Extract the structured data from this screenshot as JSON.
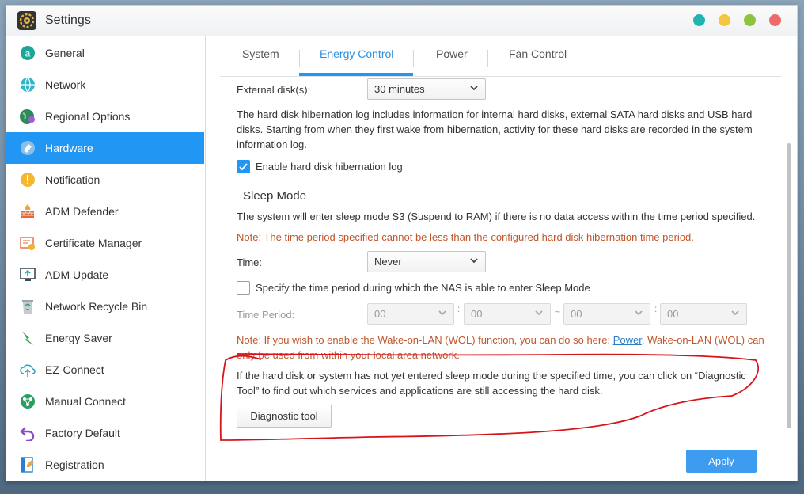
{
  "window": {
    "title": "Settings",
    "controls": {
      "teal": "#1fb4b0",
      "minimize": "#f5c542",
      "maximize": "#8bc43f",
      "close": "#ee6a6a"
    }
  },
  "sidebar": {
    "accent": "#2196f3",
    "items": [
      {
        "label": "General",
        "icon": "general-icon",
        "active": false
      },
      {
        "label": "Network",
        "icon": "globe-icon",
        "active": false
      },
      {
        "label": "Regional Options",
        "icon": "regional-globe-icon",
        "active": false
      },
      {
        "label": "Hardware",
        "icon": "hardware-icon",
        "active": true
      },
      {
        "label": "Notification",
        "icon": "exclamation-icon",
        "active": false
      },
      {
        "label": "ADM Defender",
        "icon": "firewall-icon",
        "active": false
      },
      {
        "label": "Certificate Manager",
        "icon": "certificate-icon",
        "active": false
      },
      {
        "label": "ADM Update",
        "icon": "update-monitor-icon",
        "active": false
      },
      {
        "label": "Network Recycle Bin",
        "icon": "recycle-bin-icon",
        "active": false
      },
      {
        "label": "Energy Saver",
        "icon": "lightning-icon",
        "active": false
      },
      {
        "label": "EZ-Connect",
        "icon": "cloud-upload-icon",
        "active": false
      },
      {
        "label": "Manual Connect",
        "icon": "network-nodes-icon",
        "active": false
      },
      {
        "label": "Factory Default",
        "icon": "undo-arrow-icon",
        "active": false
      },
      {
        "label": "Registration",
        "icon": "registration-icon",
        "active": false
      }
    ]
  },
  "tabs": [
    {
      "label": "System",
      "active": false
    },
    {
      "label": "Energy Control",
      "active": true
    },
    {
      "label": "Power",
      "active": false
    },
    {
      "label": "Fan Control",
      "active": false
    }
  ],
  "external_disk": {
    "label": "External disk(s):",
    "value": "30 minutes"
  },
  "hibernation_log": {
    "description": "The hard disk hibernation log includes information for internal hard disks, external SATA hard disks and USB hard disks. Starting from when they first wake from hibernation, activity for these hard disks are recorded in the system information log.",
    "checkbox_label": "Enable hard disk hibernation log",
    "checked": true
  },
  "sleep_mode": {
    "title": "Sleep Mode",
    "description": "The system will enter sleep mode S3 (Suspend to RAM) if there is no data access within the time period specified.",
    "note": "Note: The time period specified cannot be less than the configured hard disk hibernation time period.",
    "time_label": "Time:",
    "time_value": "Never",
    "specify_label": "Specify the time period during which the NAS is able to enter Sleep Mode",
    "specify_checked": false,
    "time_period_label": "Time Period:",
    "time_period": {
      "start_hour": "00",
      "start_minute": "00",
      "tilde": "~",
      "end_hour": "00",
      "end_minute": "00",
      "colon": ":"
    },
    "wol_note_prefix": "Note: If you wish to enable the Wake-on-LAN (WOL) function, you can do so here: ",
    "wol_link": "Power",
    "wol_note_suffix": ". Wake-on-LAN (WOL) can only be used from within your local area network.",
    "diagnostic_text": "If the hard disk or system has not yet entered sleep mode during the specified time, you can click on “Diagnostic Tool” to find out which services and applications are still accessing the hard disk.",
    "diagnostic_button": "Diagnostic tool"
  },
  "apply_button": "Apply",
  "colors": {
    "note": "#c0562b",
    "link": "#2a7ec7",
    "annotation": "#d8141b",
    "primary": "#3d9cf0"
  }
}
